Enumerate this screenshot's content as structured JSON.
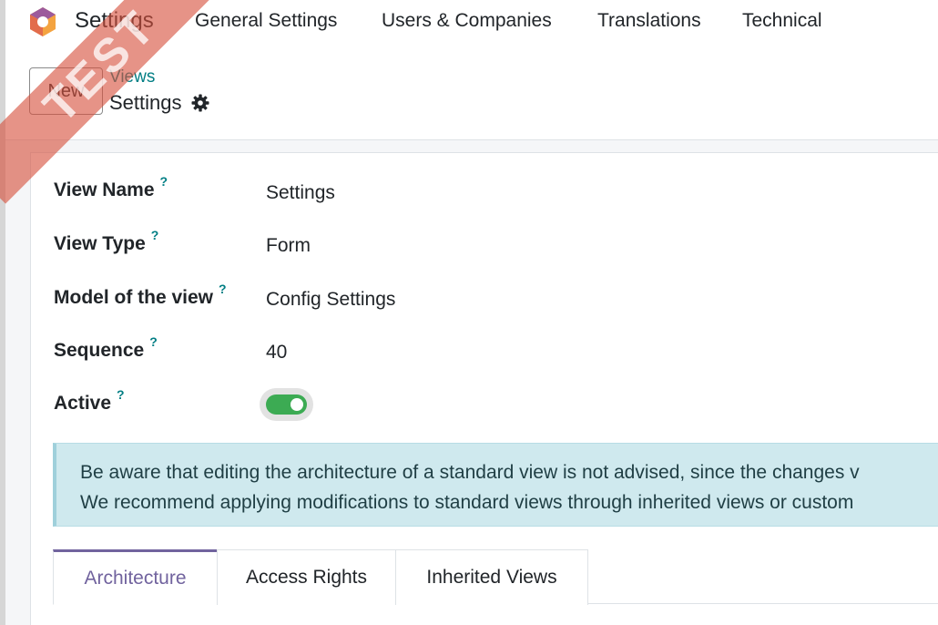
{
  "topnav": {
    "app_title": "Settings",
    "menu": [
      "General Settings",
      "Users & Companies",
      "Translations",
      "Technical"
    ]
  },
  "control_panel": {
    "new_label": "New",
    "breadcrumb_parent": "Views",
    "breadcrumb_current": "Settings"
  },
  "form": {
    "help_marker": "?",
    "fields": [
      {
        "label": "View Name",
        "value": "Settings"
      },
      {
        "label": "View Type",
        "value": "Form"
      },
      {
        "label": "Model of the view",
        "value": "Config Settings"
      },
      {
        "label": "Sequence",
        "value": "40"
      },
      {
        "label": "Active",
        "value": ""
      }
    ],
    "active": true,
    "alert_line1": "Be aware that editing the architecture of a standard view is not advised, since the changes v",
    "alert_line2": "We recommend applying modifications to standard views through inherited views or custom",
    "tabs": [
      "Architecture",
      "Access Rights",
      "Inherited Views"
    ]
  },
  "watermark": "TEST",
  "colors": {
    "accent": "#71639e",
    "link": "#017e84",
    "toggle_on": "#3cab53",
    "alert_bg": "#cfe9ee",
    "watermark": "#d6503e"
  }
}
